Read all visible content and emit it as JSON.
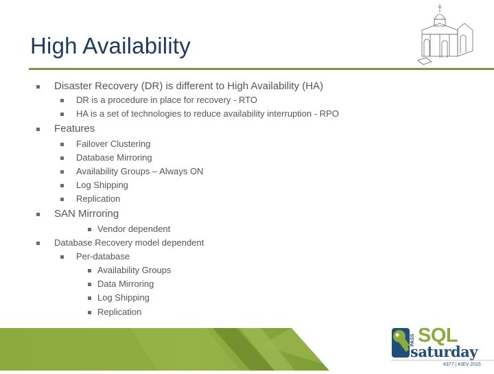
{
  "slide": {
    "title": "High Availability",
    "accent_color": "#7f9441",
    "title_color": "#1f3a5f",
    "bullets": [
      {
        "text": "Disaster Recovery (DR) is different to High Availability (HA)",
        "children": [
          {
            "text": "DR is a procedure in place for recovery - RTO"
          },
          {
            "text": "HA is a set of technologies to reduce availability interruption - RPO"
          }
        ]
      },
      {
        "text": "Features",
        "children": [
          {
            "text": "Failover Clustering"
          },
          {
            "text": "Database Mirroring"
          },
          {
            "text": "Availability Groups – Always ON"
          },
          {
            "text": "Log Shipping"
          },
          {
            "text": "Replication"
          }
        ]
      },
      {
        "text": "SAN Mirroring",
        "children": [
          {
            "text": "Vendor dependent"
          }
        ]
      },
      {
        "text": "Database Recovery model dependent",
        "children": [
          {
            "text": "Per-database",
            "children": [
              {
                "text": "Availability Groups"
              },
              {
                "text": "Data Mirroring"
              },
              {
                "text": "Log Shipping"
              },
              {
                "text": "Replication"
              }
            ]
          }
        ]
      }
    ]
  },
  "logo": {
    "pass": "PASS",
    "sql": "SQL",
    "saturday": "saturday",
    "event": "#377 | KIEV 2015"
  },
  "decor": {
    "church_icon": "church-illustration-icon",
    "key_icon": "key-icon"
  }
}
